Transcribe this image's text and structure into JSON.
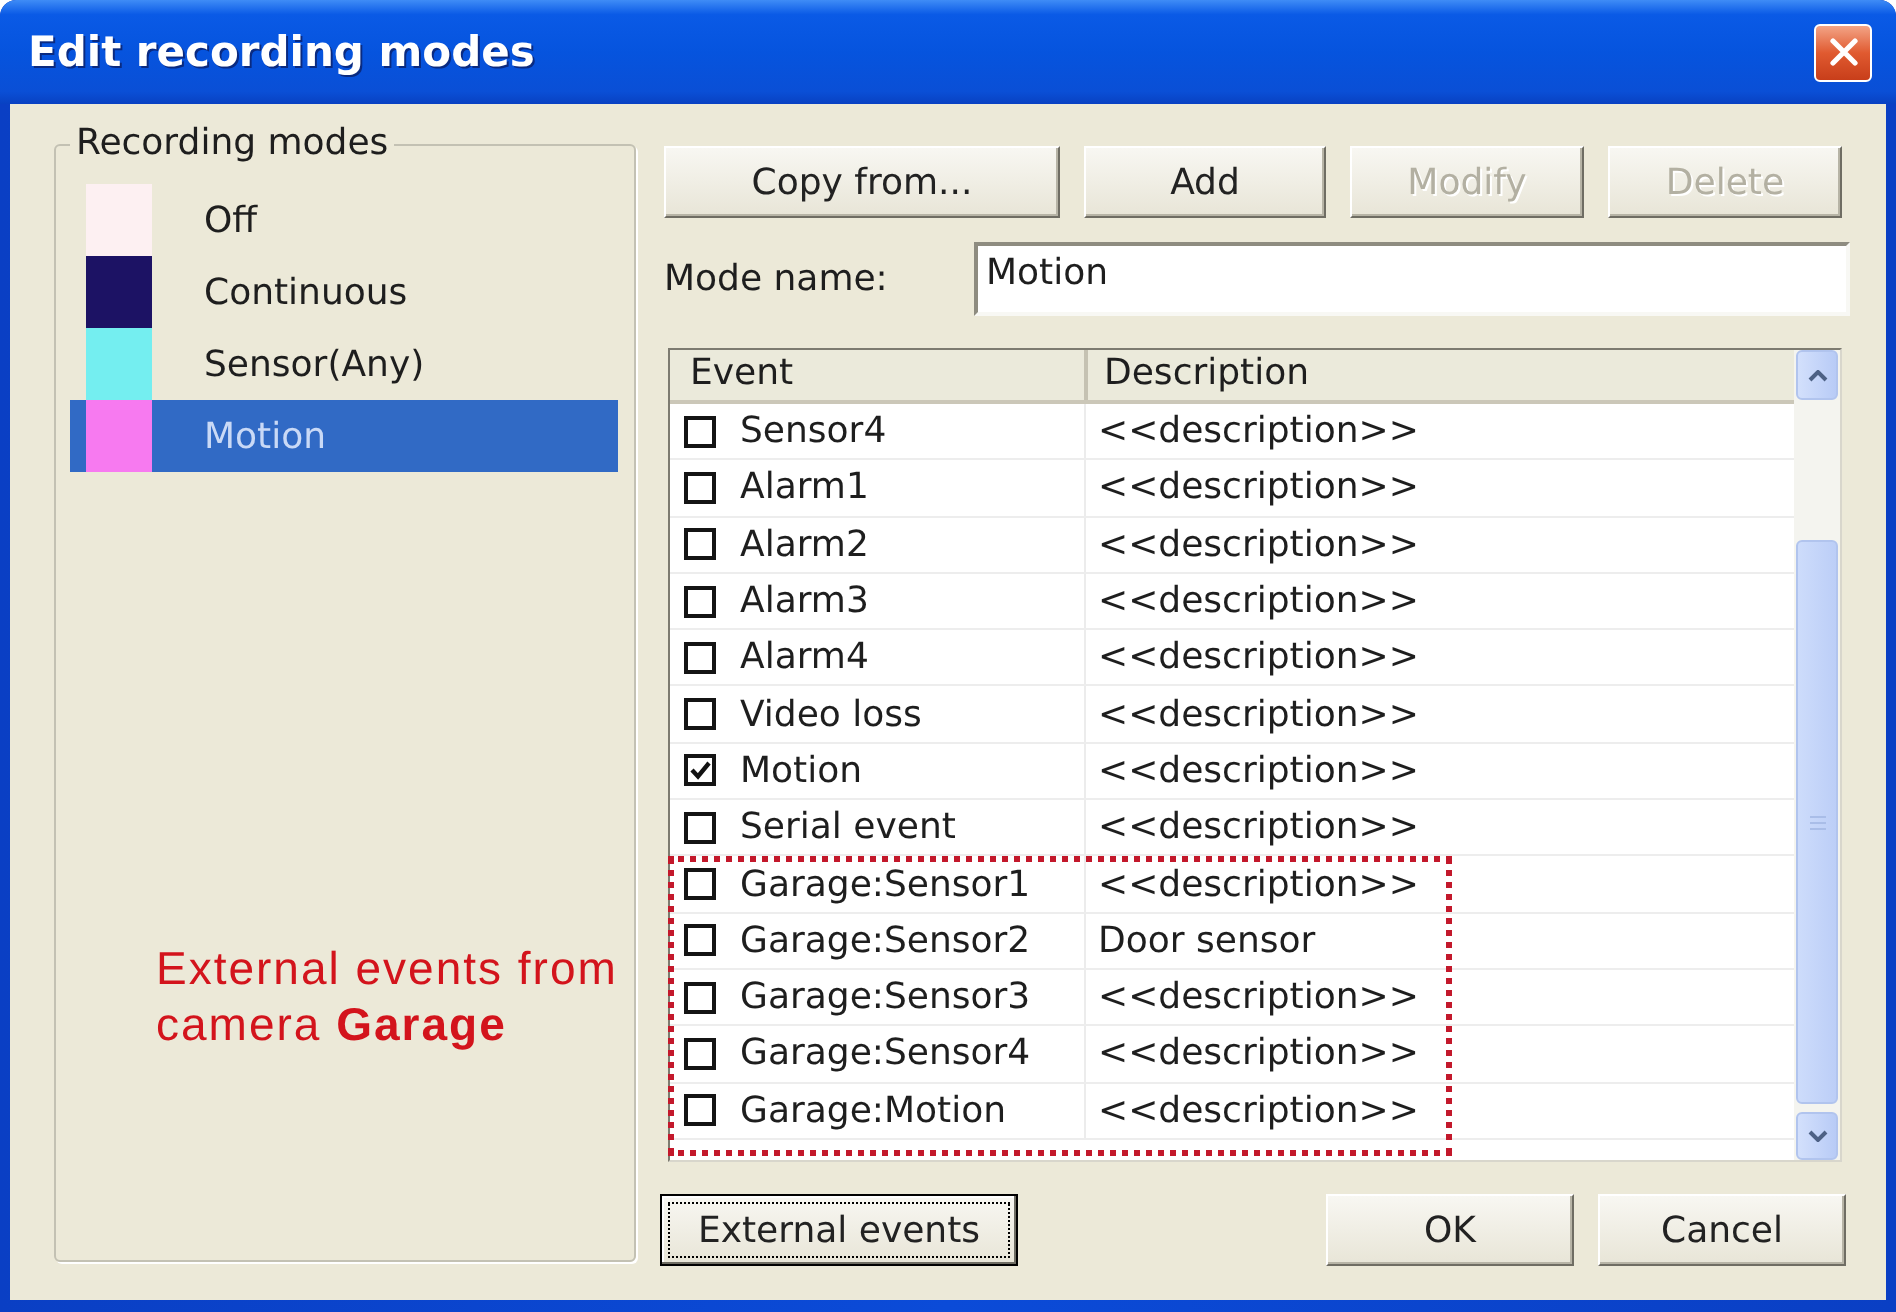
{
  "window": {
    "title": "Edit recording modes"
  },
  "modes": {
    "title": "Recording modes",
    "items": [
      {
        "label": "Off",
        "color": "#fdf0f2",
        "selected": false
      },
      {
        "label": "Continuous",
        "color": "#1c1264",
        "selected": false
      },
      {
        "label": "Sensor(Any)",
        "color": "#74eef0",
        "selected": false
      },
      {
        "label": "Motion",
        "color": "#f77af0",
        "selected": true
      }
    ]
  },
  "annotation": {
    "text": "External events from camera **Garage**"
  },
  "buttons": [
    {
      "label": "Copy from...",
      "disabled": false
    },
    {
      "label": "Add",
      "disabled": false
    },
    {
      "label": "Modify",
      "disabled": true
    },
    {
      "label": "Delete",
      "disabled": true
    }
  ],
  "mode_name": {
    "label": "Mode name:",
    "value": "Motion"
  },
  "table": {
    "columns": [
      "Event",
      "Description"
    ],
    "rows": [
      {
        "event": "Sensor4",
        "description": "<<description>>",
        "checked": false
      },
      {
        "event": "Alarm1",
        "description": "<<description>>",
        "checked": false
      },
      {
        "event": "Alarm2",
        "description": "<<description>>",
        "checked": false
      },
      {
        "event": "Alarm3",
        "description": "<<description>>",
        "checked": false
      },
      {
        "event": "Alarm4",
        "description": "<<description>>",
        "checked": false
      },
      {
        "event": "Video loss",
        "description": "<<description>>",
        "checked": false
      },
      {
        "event": "Motion",
        "description": "<<description>>",
        "checked": true
      },
      {
        "event": "Serial event",
        "description": "<<description>>",
        "checked": false
      }
    ],
    "external_rows": [
      {
        "event": "Garage:Sensor1",
        "description": "<<description>>",
        "checked": false
      },
      {
        "event": "Garage:Sensor2",
        "description": "Door sensor",
        "checked": false
      },
      {
        "event": "Garage:Sensor3",
        "description": "<<description>>",
        "checked": false
      },
      {
        "event": "Garage:Sensor4",
        "description": "<<description>>",
        "checked": false
      },
      {
        "event": "Garage:Motion",
        "description": "<<description>>",
        "checked": false
      }
    ]
  },
  "footer_buttons": [
    {
      "label": "External events",
      "focused": true
    },
    {
      "label": "OK",
      "focused": false
    },
    {
      "label": "Cancel",
      "focused": false
    }
  ]
}
